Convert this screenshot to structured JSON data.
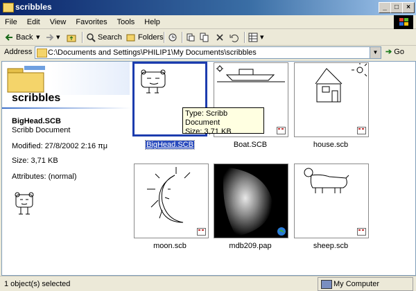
{
  "window": {
    "title": "scribbles"
  },
  "menu": [
    "File",
    "Edit",
    "View",
    "Favorites",
    "Tools",
    "Help"
  ],
  "toolbar": {
    "back": "Back",
    "search": "Search",
    "folders": "Folders"
  },
  "address": {
    "label": "Address",
    "value": "C:\\Documents and Settings\\PHILIP1\\My Documents\\scribbles",
    "go": "Go"
  },
  "details": {
    "folder_name": "scribbles",
    "file_name": "BigHead.SCB",
    "file_type": "Scribb Document",
    "modified": "Modified: 27/8/2002 2:16 πμ",
    "size": "Size: 3,71 KB",
    "attributes": "Attributes: (normal)"
  },
  "tooltip": {
    "type": "Type: Scribb Document",
    "size": "Size: 3,71 KB"
  },
  "files": [
    {
      "name": "BigHead.SCB",
      "icon": "bighead-scribble",
      "selected": true
    },
    {
      "name": "Boat.SCB",
      "icon": "boat-scribble"
    },
    {
      "name": "house.scb",
      "icon": "house-scribble"
    },
    {
      "name": "moon.scb",
      "icon": "moon-scribble"
    },
    {
      "name": "mdb209.pap",
      "icon": "mammogram-image"
    },
    {
      "name": "sheep.scb",
      "icon": "sheep-scribble"
    }
  ],
  "status": {
    "selected": "1 object(s) selected",
    "location": "My Computer"
  }
}
